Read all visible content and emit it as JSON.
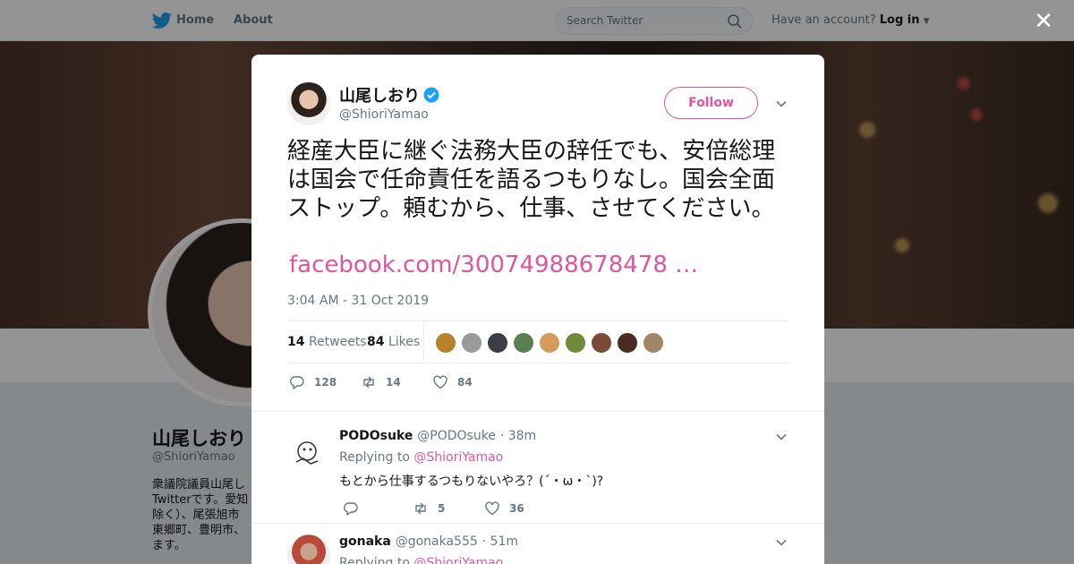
{
  "topbar": {
    "home_label": "Home",
    "about_label": "About",
    "search_placeholder": "Search Twitter",
    "have_account": "Have an account?",
    "login_label": "Log in"
  },
  "profile": {
    "name": "山尾しおり",
    "handle": "@ShioriYamao",
    "bio": "衆議院議員山尾し\nTwitterです。愛知\n除く）、尾張旭市\n東郷町、豊明市、\nます。"
  },
  "tweet": {
    "name": "山尾しおり",
    "handle": "@ShioriYamao",
    "follow_label": "Follow",
    "text": "経産大臣に継ぐ法務大臣の辞任でも、安倍総理は国会で任命責任を語るつもりなし。国会全面ストップ。頼むから、仕事、させてください。",
    "link": "facebook.com/30074988678478 …",
    "timestamp": "3:04 AM - 31 Oct 2019",
    "retweets_count": "14",
    "retweets_label": "Retweets",
    "likes_count": "84",
    "likes_label": "Likes",
    "reply_count": "128",
    "retweet_action_count": "14",
    "like_action_count": "84",
    "liker_colors": [
      "#b7812a",
      "#9a9a9a",
      "#3b3f45",
      "#5a7f52",
      "#d49b5a",
      "#6f8b3a",
      "#7a4a34",
      "#4a2c22",
      "#a3856a"
    ]
  },
  "replies": [
    {
      "name": "PODOsuke",
      "handle": "@PODOsuke",
      "time": "· 38m",
      "replying_prefix": "Replying to",
      "replying_to": "@ShioriYamao",
      "text": "もとから仕事するつもりないやろ？(´・ω・`)?",
      "reply_count": "",
      "retweet_count": "5",
      "like_count": "36"
    },
    {
      "name": "gonaka",
      "handle": "@gonaka555",
      "time": "· 51m",
      "replying_prefix": "Replying to",
      "replying_to": "@ShioriYamao"
    }
  ],
  "colors": {
    "accent": "#e0559d",
    "twitter_blue": "#1da1f2",
    "muted": "#657786"
  }
}
